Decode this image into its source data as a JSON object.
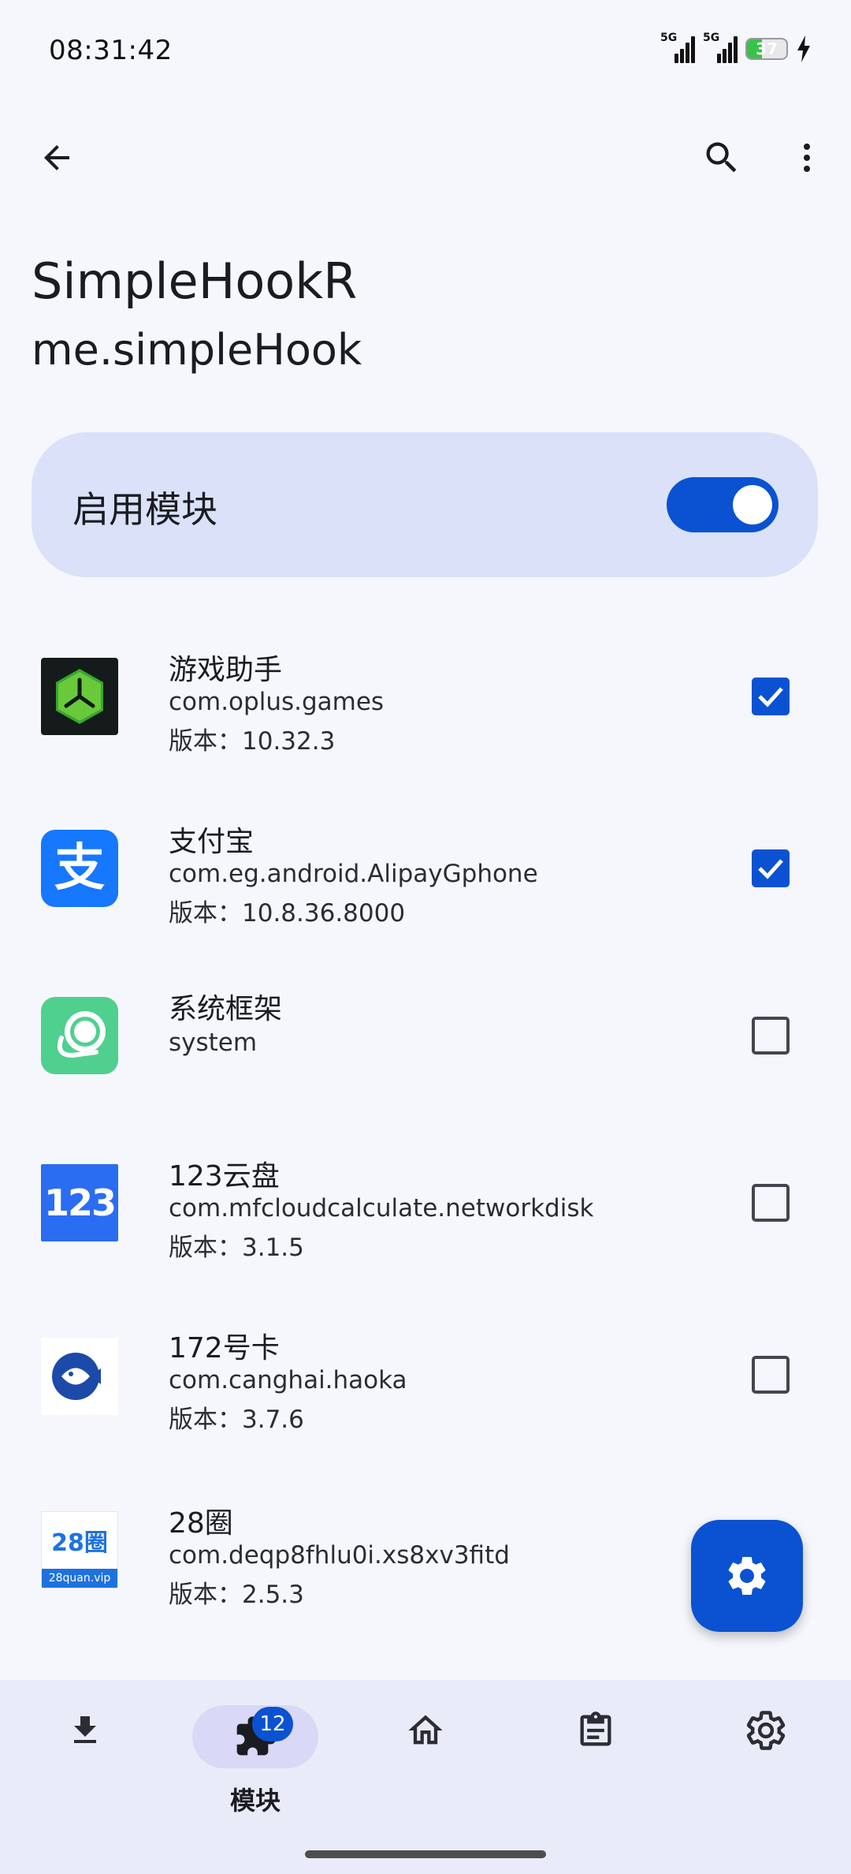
{
  "status": {
    "time": "08:31:42",
    "signal1_label": "5G",
    "signal2_label": "5G",
    "battery_level": "37"
  },
  "header": {
    "title": "SimpleHookR",
    "package": "me.simpleHook"
  },
  "enable_card": {
    "label": "启用模块",
    "enabled": true
  },
  "apps": [
    {
      "name": "游戏助手",
      "package": "com.oplus.games",
      "version": "版本：10.32.3",
      "checked": true
    },
    {
      "name": "支付宝",
      "package": "com.eg.android.AlipayGphone",
      "version": "版本：10.8.36.8000",
      "checked": true
    },
    {
      "name": "系统框架",
      "package": "system",
      "version": "",
      "checked": false
    },
    {
      "name": "123云盘",
      "package": "com.mfcloudcalculate.networkdisk",
      "version": "版本：3.1.5",
      "checked": false
    },
    {
      "name": "172号卡",
      "package": "com.canghai.haoka",
      "version": "版本：3.7.6",
      "checked": false
    },
    {
      "name": "28圈",
      "package": "com.deqp8fhlu0i.xs8xv3fitd",
      "version": "版本：2.5.3",
      "checked": false
    }
  ],
  "icons": {
    "app1": {
      "text": ""
    },
    "app2": {
      "text": "支"
    },
    "app4": {
      "text": "123"
    },
    "app6": {
      "text_top": "28圈",
      "text_bottom": "28quan.vip"
    }
  },
  "nav": {
    "active_label": "模块",
    "badge": "12"
  },
  "colors": {
    "accent": "#0a52d1",
    "card": "#dae1f9",
    "background": "#f6f7fd"
  }
}
